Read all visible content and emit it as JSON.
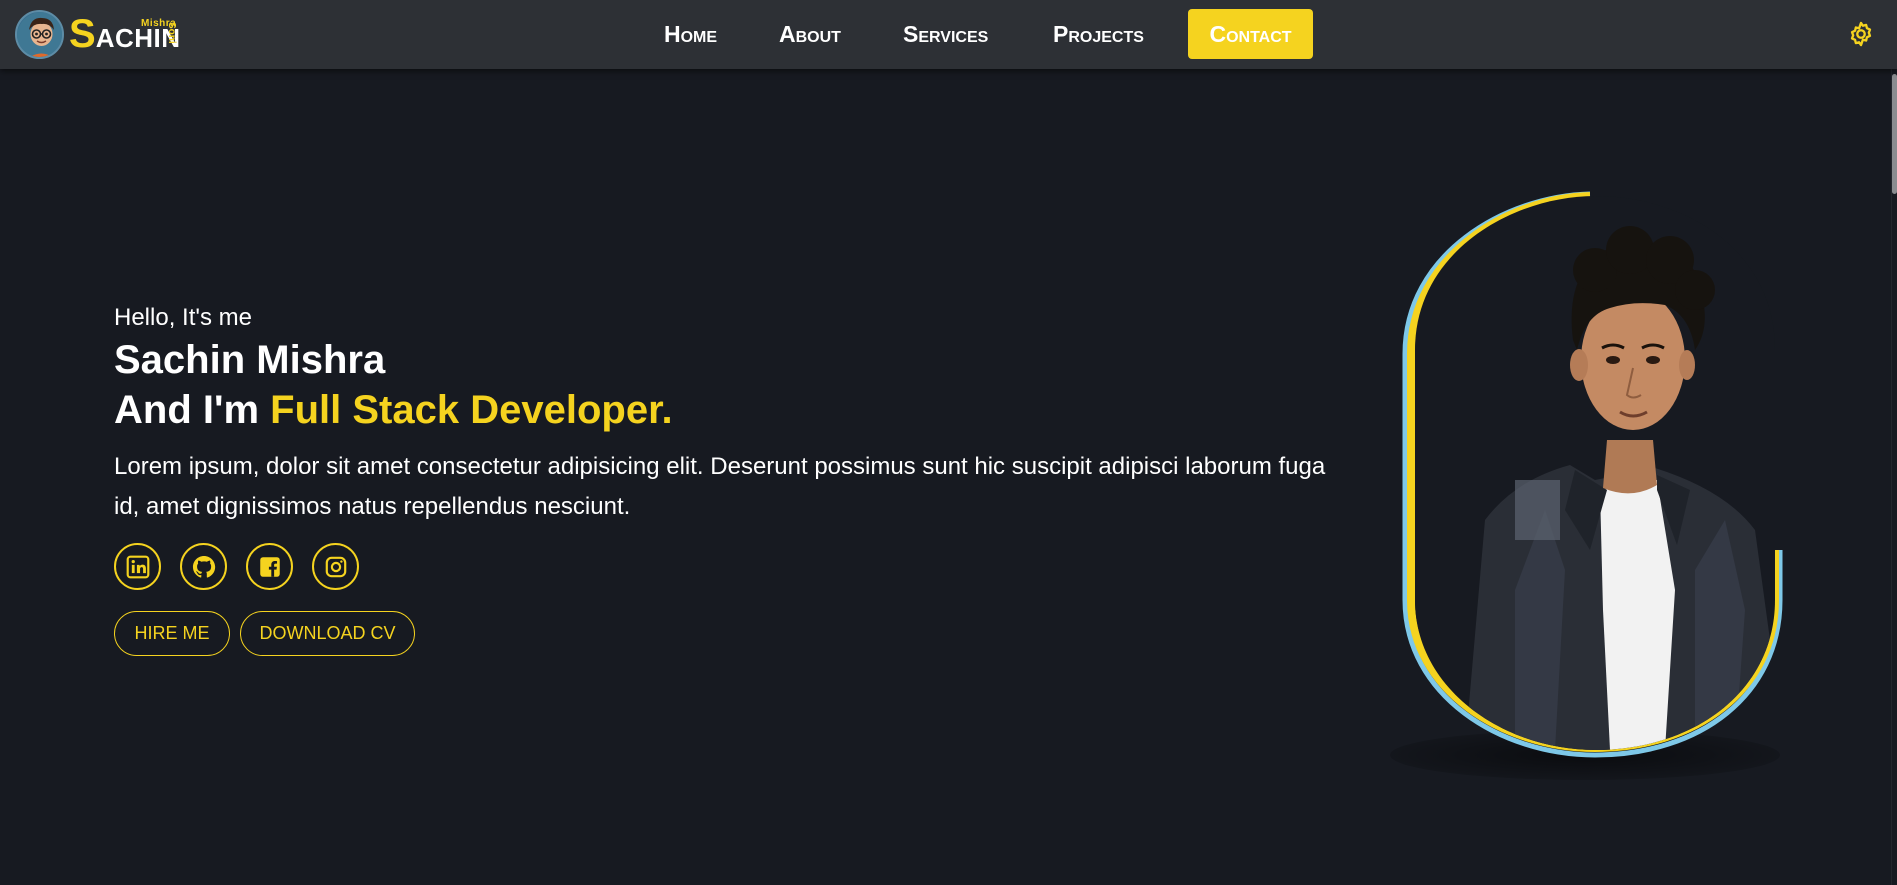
{
  "header": {
    "logo": {
      "letter": "S",
      "rest": "ACHIN",
      "small_top": "Mishra",
      "small_side": "Soni"
    },
    "nav": [
      {
        "label": "Home"
      },
      {
        "label": "About"
      },
      {
        "label": "Services"
      },
      {
        "label": "Projects"
      },
      {
        "label": "Contact"
      }
    ],
    "settings_icon": "gear-icon"
  },
  "hero": {
    "greeting": "Hello, It's me",
    "name": "Sachin Mishra",
    "role_prefix": "And I'm ",
    "role_highlight": "Full Stack Developer.",
    "bio": "Lorem ipsum, dolor sit amet consectetur adipisicing elit. Deserunt possimus sunt hic suscipit adipisci laborum fuga id, amet dignissimos natus repellendus nesciunt.",
    "socials": [
      {
        "icon": "linkedin-icon"
      },
      {
        "icon": "github-icon"
      },
      {
        "icon": "facebook-icon"
      },
      {
        "icon": "instagram-icon"
      }
    ],
    "buttons": {
      "hire": "HIRE ME",
      "cv": "DOWNLOAD CV"
    }
  },
  "colors": {
    "accent": "#f5d31f",
    "background": "#171a21",
    "navbar": "#2d3035",
    "frame_blue": "#7ec8e8"
  }
}
